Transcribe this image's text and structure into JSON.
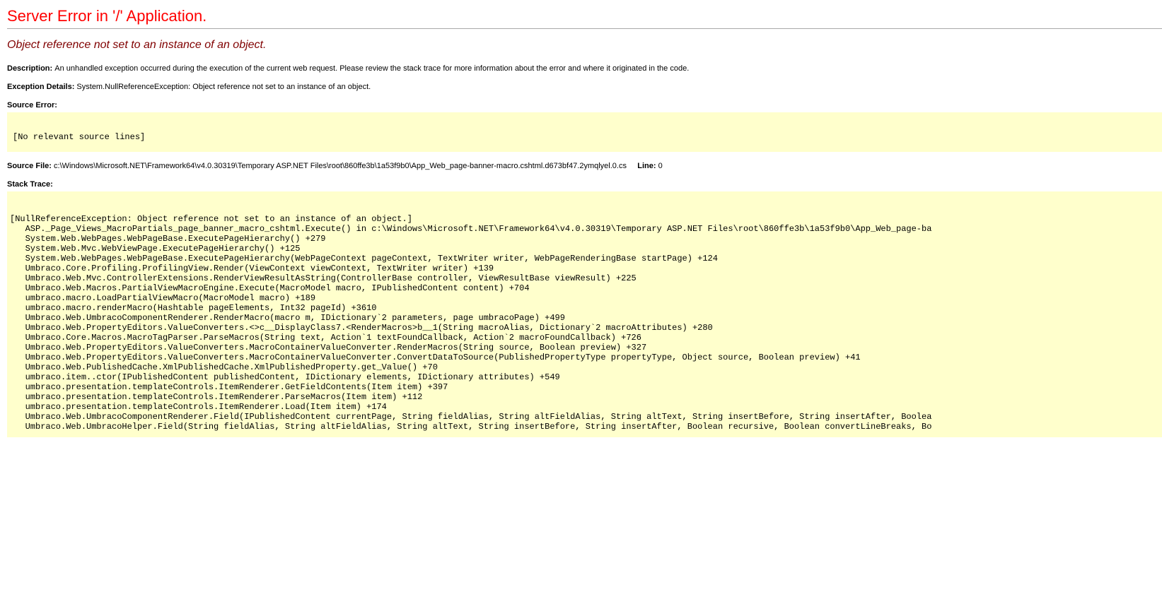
{
  "title": "Server Error in '/' Application.",
  "subtitle": "Object reference not set to an instance of an object.",
  "description_label": "Description: ",
  "description_text": "An unhandled exception occurred during the execution of the current web request. Please review the stack trace for more information about the error and where it originated in the code.",
  "exception_label": "Exception Details: ",
  "exception_text": "System.NullReferenceException: Object reference not set to an instance of an object.",
  "source_error_label": "Source Error:",
  "source_error_code": "\n[No relevant source lines]",
  "source_file_label": "Source File: ",
  "source_file_text": "c:\\Windows\\Microsoft.NET\\Framework64\\v4.0.30319\\Temporary ASP.NET Files\\root\\860ffe3b\\1a53f9b0\\App_Web_page-banner-macro.cshtml.d673bf47.2ymqlyel.0.cs",
  "line_label": "Line: ",
  "line_text": "0",
  "stack_label": "Stack Trace:",
  "stack_trace": "\n[NullReferenceException: Object reference not set to an instance of an object.]\n   ASP._Page_Views_MacroPartials_page_banner_macro_cshtml.Execute() in c:\\Windows\\Microsoft.NET\\Framework64\\v4.0.30319\\Temporary ASP.NET Files\\root\\860ffe3b\\1a53f9b0\\App_Web_page-ba\n   System.Web.WebPages.WebPageBase.ExecutePageHierarchy() +279\n   System.Web.Mvc.WebViewPage.ExecutePageHierarchy() +125\n   System.Web.WebPages.WebPageBase.ExecutePageHierarchy(WebPageContext pageContext, TextWriter writer, WebPageRenderingBase startPage) +124\n   Umbraco.Core.Profiling.ProfilingView.Render(ViewContext viewContext, TextWriter writer) +139\n   Umbraco.Web.Mvc.ControllerExtensions.RenderViewResultAsString(ControllerBase controller, ViewResultBase viewResult) +225\n   Umbraco.Web.Macros.PartialViewMacroEngine.Execute(MacroModel macro, IPublishedContent content) +704\n   umbraco.macro.LoadPartialViewMacro(MacroModel macro) +189\n   umbraco.macro.renderMacro(Hashtable pageElements, Int32 pageId) +3610\n   Umbraco.Web.UmbracoComponentRenderer.RenderMacro(macro m, IDictionary`2 parameters, page umbracoPage) +499\n   Umbraco.Web.PropertyEditors.ValueConverters.<>c__DisplayClass7.<RenderMacros>b__1(String macroAlias, Dictionary`2 macroAttributes) +280\n   Umbraco.Core.Macros.MacroTagParser.ParseMacros(String text, Action`1 textFoundCallback, Action`2 macroFoundCallback) +726\n   Umbraco.Web.PropertyEditors.ValueConverters.MacroContainerValueConverter.RenderMacros(String source, Boolean preview) +327\n   Umbraco.Web.PropertyEditors.ValueConverters.MacroContainerValueConverter.ConvertDataToSource(PublishedPropertyType propertyType, Object source, Boolean preview) +41\n   Umbraco.Web.PublishedCache.XmlPublishedCache.XmlPublishedProperty.get_Value() +70\n   umbraco.item..ctor(IPublishedContent publishedContent, IDictionary elements, IDictionary attributes) +549\n   umbraco.presentation.templateControls.ItemRenderer.GetFieldContents(Item item) +397\n   umbraco.presentation.templateControls.ItemRenderer.ParseMacros(Item item) +112\n   umbraco.presentation.templateControls.ItemRenderer.Load(Item item) +174\n   Umbraco.Web.UmbracoComponentRenderer.Field(IPublishedContent currentPage, String fieldAlias, String altFieldAlias, String altText, String insertBefore, String insertAfter, Boolea\n   Umbraco.Web.UmbracoHelper.Field(String fieldAlias, String altFieldAlias, String altText, String insertBefore, String insertAfter, Boolean recursive, Boolean convertLineBreaks, Bo"
}
